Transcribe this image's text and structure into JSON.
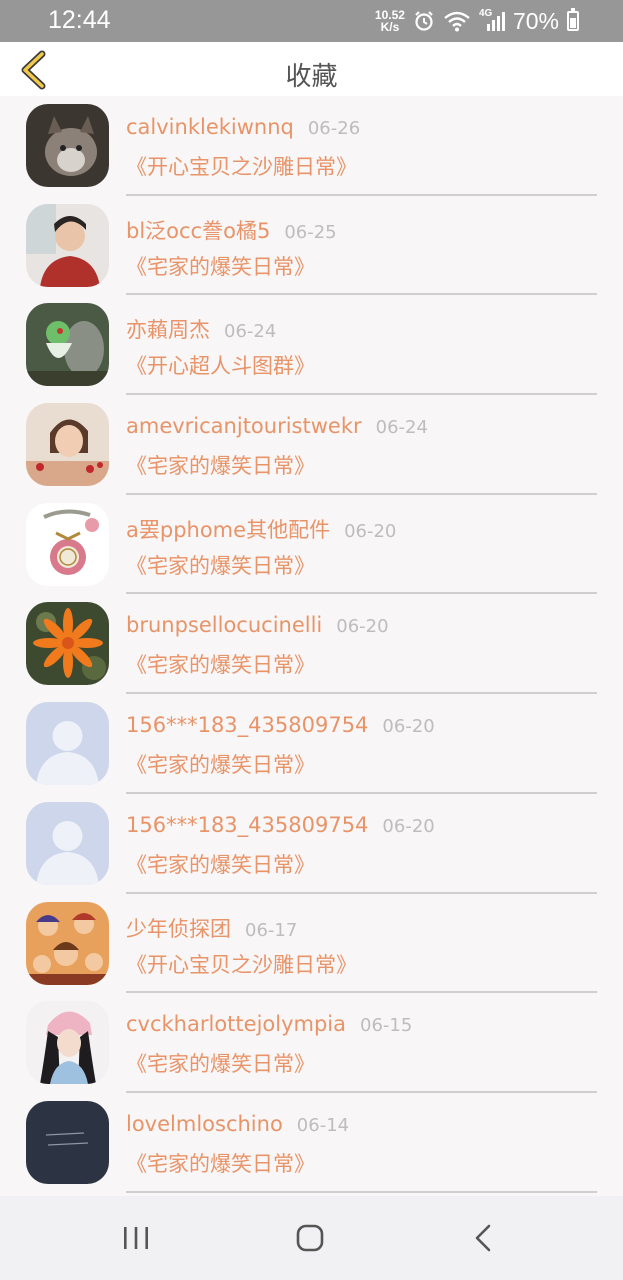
{
  "status_bar": {
    "time": "12:44",
    "speed_value": "10.52",
    "speed_unit": "K/s",
    "network": "4G",
    "battery": "70%"
  },
  "header": {
    "title": "收藏",
    "back_icon": "chevron-left-icon"
  },
  "favorites": [
    {
      "name": "calvinklekiwnnq",
      "date": "06-26",
      "group": "《开心宝贝之沙雕日常》"
    },
    {
      "name": "bl泛occ誊o橘5",
      "date": "06-25",
      "group": "《宅家的爆笑日常》"
    },
    {
      "name": "亦藾周杰",
      "date": "06-24",
      "group": "《开心超人斗图群》"
    },
    {
      "name": "amevricanjtouristwekr",
      "date": "06-24",
      "group": "《宅家的爆笑日常》"
    },
    {
      "name": "a罢pphome其他配件",
      "date": "06-20",
      "group": "《宅家的爆笑日常》"
    },
    {
      "name": "brunpsellocucinelli",
      "date": "06-20",
      "group": "《宅家的爆笑日常》"
    },
    {
      "name": "156***183_435809754",
      "date": "06-20",
      "group": "《宅家的爆笑日常》"
    },
    {
      "name": "156***183_435809754",
      "date": "06-20",
      "group": "《宅家的爆笑日常》"
    },
    {
      "name": "少年侦探团",
      "date": "06-17",
      "group": "《开心宝贝之沙雕日常》"
    },
    {
      "name": "cvckharlottejolympia",
      "date": "06-15",
      "group": "《宅家的爆笑日常》"
    },
    {
      "name": "lovelmloschino",
      "date": "06-14",
      "group": "《宅家的爆笑日常》"
    }
  ],
  "nav_bar": {
    "recents_icon": "recents-icon",
    "home_icon": "home-icon",
    "back_icon": "back-icon"
  },
  "colors": {
    "accent": "#e89468",
    "date": "#bdbdbd",
    "status_bar": "#979797"
  }
}
